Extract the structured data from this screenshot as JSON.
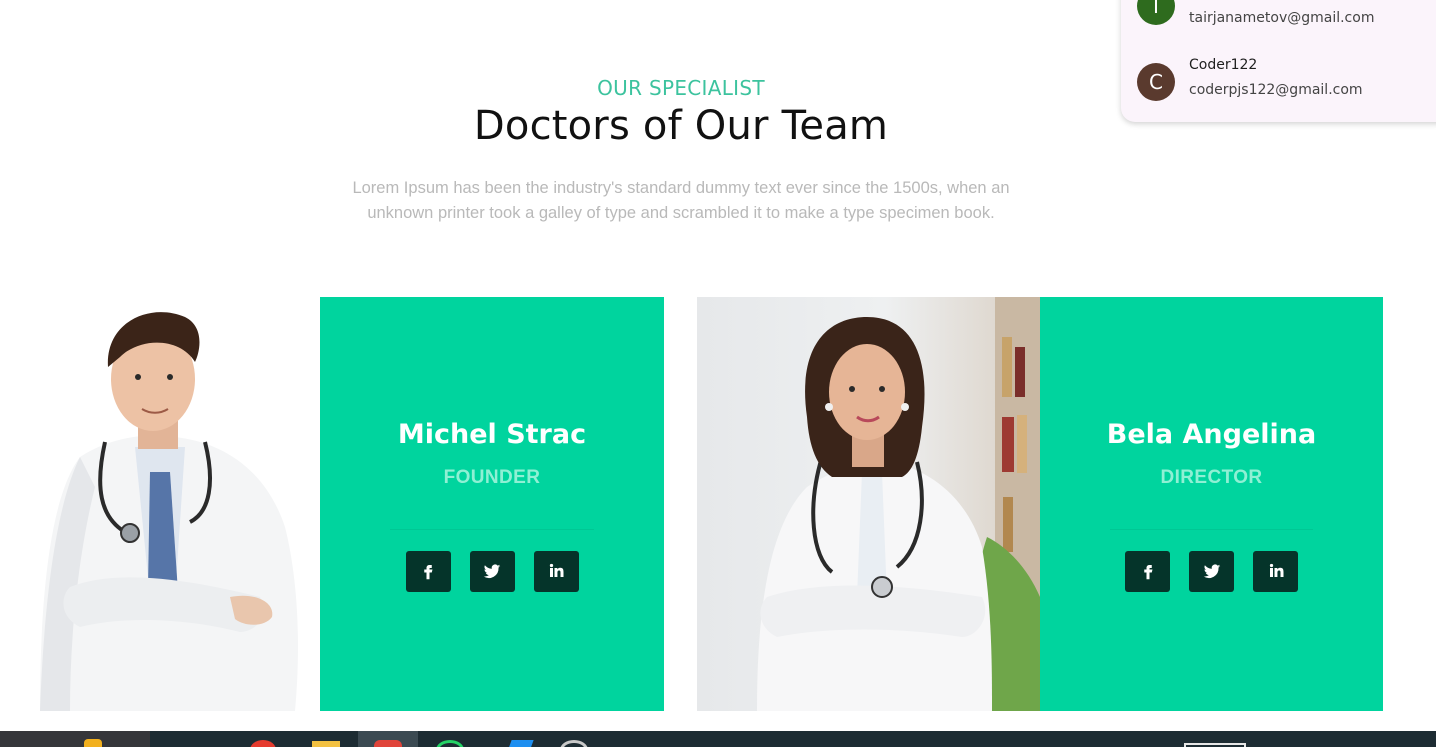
{
  "section": {
    "eyebrow": "OUR SPECIALIST",
    "title": "Doctors of Our Team",
    "lede_line1": "Lorem Ipsum has been the industry's standard dummy text ever since the 1500s, when an",
    "lede_line2": "unknown printer took a galley of type and scrambled it to make a type specimen book."
  },
  "doctors": [
    {
      "name": "Michel Strac",
      "role": "FOUNDER"
    },
    {
      "name": "Bela Angelina",
      "role": "DIRECTOR"
    }
  ],
  "social_icons": [
    "facebook-icon",
    "twitter-icon",
    "linkedin-icon"
  ],
  "accounts": [
    {
      "initial": "T",
      "name": "",
      "email": "tairjanametov@gmail.com",
      "color": "#2e6b1e"
    },
    {
      "initial": "C",
      "name": "Coder122",
      "email": "coderpjs122@gmail.com",
      "color": "#5a3a2e"
    }
  ],
  "colors": {
    "accent": "#00d49e",
    "eyebrow": "#3cc39e",
    "social_button": "#05342a",
    "role_text": "#8ff0d4"
  }
}
